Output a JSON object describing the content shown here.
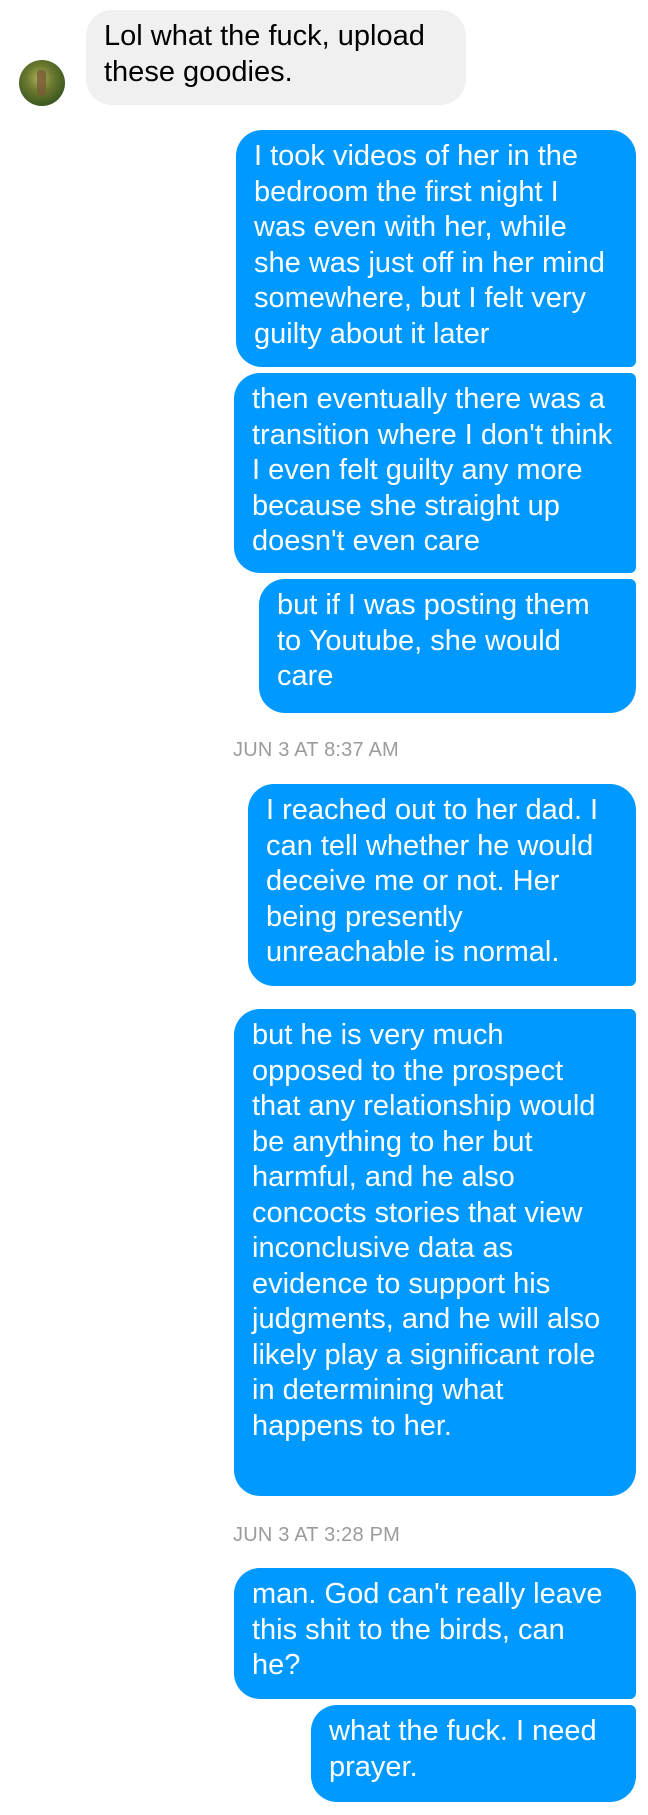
{
  "conversation": {
    "received": [
      {
        "text": "Lol what the fuck, upload these goodies."
      }
    ],
    "avatar_icon": "contact-avatar-icon",
    "sent_group_1": [
      {
        "text": "I took videos of her in the bedroom the first night I was even with her, while she was just off in her mind somewhere, but I felt very guilty about it later"
      },
      {
        "text": "then eventually there was a transition where I don't think I even felt guilty any more because she straight up doesn't even care"
      },
      {
        "text": "but if I was posting them to Youtube, she would care"
      }
    ],
    "timestamp_1": "JUN 3 AT 8:37 AM",
    "sent_group_2": [
      {
        "text": "I reached out to her dad. I can tell whether he would deceive me or not. Her being presently unreachable is normal."
      },
      {
        "text": "but he is very much opposed to the prospect that any relationship would be anything to her but harmful, and he also concocts stories that view inconclusive data as evidence to support his judgments, and he will also likely play a significant role in determining what happens to her."
      }
    ],
    "timestamp_2": "JUN 3 AT 3:28 PM",
    "sent_group_3": [
      {
        "text": "man. God can't really leave this shit to the birds, can he?"
      },
      {
        "text": "what the fuck. I need prayer."
      }
    ]
  },
  "colors": {
    "sent_bubble": "#0099ff",
    "received_bubble": "#f1f0f0",
    "timestamp": "#9b9b9b"
  }
}
